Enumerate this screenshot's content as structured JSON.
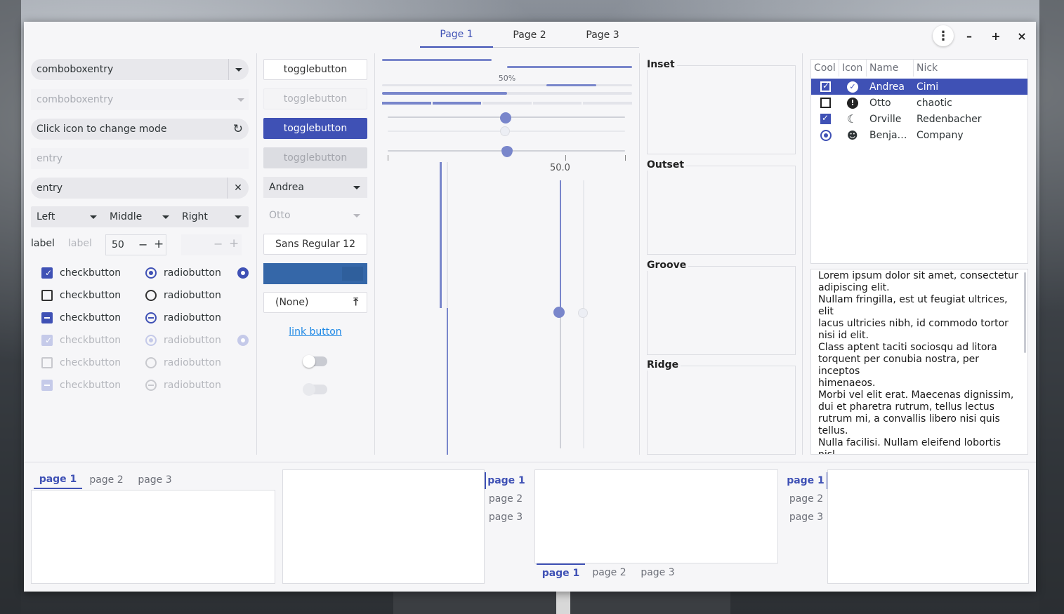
{
  "header": {
    "tabs": [
      {
        "label": "Page 1",
        "active": true
      },
      {
        "label": "Page 2",
        "active": false
      },
      {
        "label": "Page 3",
        "active": false
      }
    ],
    "menu_icon": "vertical-ellipsis-icon",
    "window_buttons": {
      "minimize": "–",
      "maximize": "+",
      "close": "×"
    }
  },
  "col1": {
    "combo1": "comboboxentry",
    "combo2": "comboboxentry",
    "entry_mode": "Click icon to change mode",
    "entry_disabled_placeholder": "entry",
    "entry_clear": "entry",
    "segment": [
      "Left",
      "Middle",
      "Right"
    ],
    "spin_label": "label",
    "spin_label_dim": "label",
    "spin_value": "50",
    "spin_minus": "−",
    "spin_plus": "+",
    "checks": [
      "checkbutton",
      "checkbutton",
      "checkbutton",
      "checkbutton",
      "checkbutton",
      "checkbutton"
    ],
    "radios": [
      "radiobutton",
      "radiobutton",
      "radiobutton",
      "radiobutton",
      "radiobutton",
      "radiobutton"
    ]
  },
  "col2": {
    "toggles": [
      "togglebutton",
      "togglebutton",
      "togglebutton",
      "togglebutton"
    ],
    "combo_active": "Andrea",
    "combo_dim": "Otto",
    "font_name": "Sans Regular",
    "font_size": "12",
    "file_button": "(None)",
    "link": "link button"
  },
  "col3": {
    "progress_label": "50%",
    "scale_value": "50.0",
    "progress_fraction": 0.5
  },
  "frames": [
    "Inset",
    "Outset",
    "Groove",
    "Ridge"
  ],
  "tree": {
    "headers": [
      "Cool",
      "Icon",
      "Name",
      "Nick"
    ],
    "rows": [
      {
        "cool": "check",
        "icon": "check-circle-icon",
        "name": "Andrea",
        "nick": "Cimi",
        "selected": true
      },
      {
        "cool": "box",
        "icon": "exclamation-circle-icon",
        "name": "Otto",
        "nick": "chaotic",
        "selected": false
      },
      {
        "cool": "check",
        "icon": "moon-icon",
        "name": "Orville",
        "nick": "Redenbacher",
        "selected": false
      },
      {
        "cool": "radio",
        "icon": "emoji-icon",
        "name": "Benja…",
        "nick": "Company",
        "selected": false
      }
    ]
  },
  "textview": {
    "text": "Lorem ipsum dolor sit amet, consectetur\nadipiscing elit.\nNullam fringilla, est ut feugiat ultrices, elit\nlacus ultricies nibh, id commodo tortor\nnisi id elit.\nClass aptent taciti sociosqu ad litora\ntorquent per conubia nostra, per inceptos\nhimenaeos.\nMorbi vel elit erat. Maecenas dignissim,\ndui et pharetra rutrum, tellus lectus\nrutrum mi, a convallis libero nisi quis tellus.\nNulla facilisi. Nullam eleifend lobortis nisl,\nin porttitor tellus malesuada vitae.\nAenean lacus tellus, pellentesque quis\nmolestie quis, fringilla in arcu.\nDuis elementum, tellus sed tristique"
  },
  "notebooks": {
    "nb1": [
      "page 1",
      "page 2",
      "page 3"
    ],
    "nb2": [
      "page 1",
      "page 2",
      "page 3"
    ],
    "nb3": [
      "page 1",
      "page 2",
      "page 3"
    ],
    "nb4": [
      "page 1",
      "page 2",
      "page 3"
    ]
  },
  "colors": {
    "accent": "#3f51b5",
    "accent_light": "#7986cb",
    "link": "#1e88e5"
  }
}
